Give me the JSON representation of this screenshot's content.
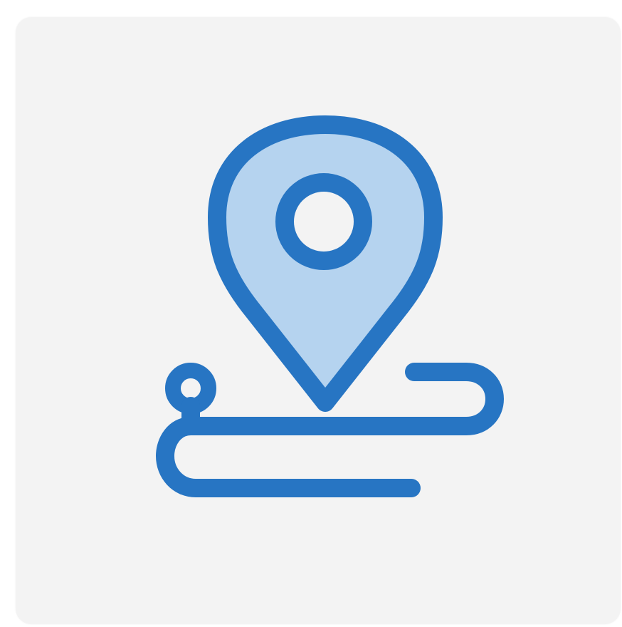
{
  "icon": {
    "name": "location-route-icon",
    "colors": {
      "stroke": "#2775c3",
      "fill": "#b5d3ef",
      "background": "#f3f3f3"
    }
  }
}
